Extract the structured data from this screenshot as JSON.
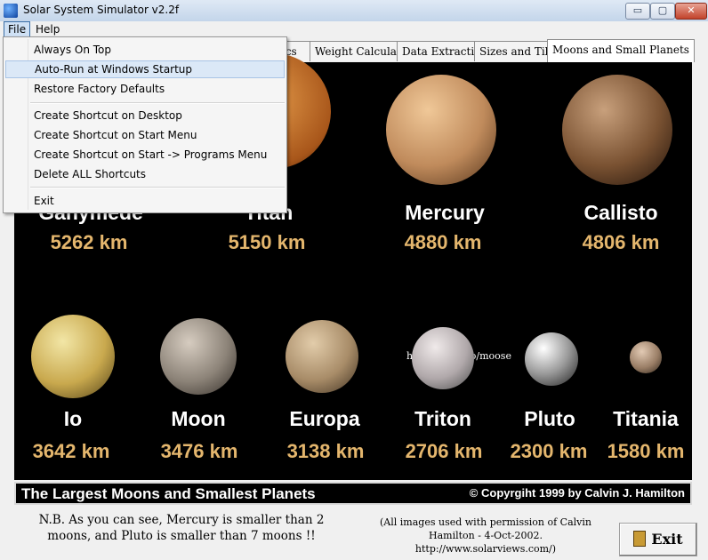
{
  "window": {
    "title": "Solar System Simulator v2.2f",
    "controls": {
      "minimize": "▭",
      "maximize": "▢",
      "close": "✕"
    }
  },
  "menubar": {
    "file": "File",
    "help": "Help"
  },
  "tabs": [
    {
      "label": "stics"
    },
    {
      "label": "Weight Calculator"
    },
    {
      "label": "Data Extraction"
    },
    {
      "label": "Sizes and Tilts"
    },
    {
      "label": "Moons and Small Planets",
      "active": true
    }
  ],
  "file_menu": {
    "items": [
      {
        "label": "Always On Top"
      },
      {
        "label": "Auto-Run at Windows Startup",
        "highlighted": true
      },
      {
        "label": "Restore Factory Defaults"
      },
      {
        "label": "Create Shortcut on Desktop"
      },
      {
        "label": "Create Shortcut on Start Menu"
      },
      {
        "label": "Create Shortcut on Start -> Programs Menu"
      },
      {
        "label": "Delete ALL Shortcuts"
      },
      {
        "label": "Exit"
      }
    ]
  },
  "bodies_row1": [
    {
      "name": "Ganymede",
      "size": "5262 km",
      "color": "#8a7560"
    },
    {
      "name": "Titan",
      "size": "5150 km",
      "color": "#d67a2e"
    },
    {
      "name": "Mercury",
      "size": "4880 km",
      "color": "#c8976a"
    },
    {
      "name": "Callisto",
      "size": "4806 km",
      "color": "#7e5e45"
    }
  ],
  "bodies_row2": [
    {
      "name": "Io",
      "size": "3642 km",
      "color": "#d9c070"
    },
    {
      "name": "Moon",
      "size": "3476 km",
      "color": "#9e948a"
    },
    {
      "name": "Europa",
      "size": "3138 km",
      "color": "#b69a74"
    },
    {
      "name": "Triton",
      "size": "2706 km",
      "color": "#c9c3c4"
    },
    {
      "name": "Pluto",
      "size": "2300 km",
      "color": "#bdbdbd"
    },
    {
      "name": "Titania",
      "size": "1580 km",
      "color": "#b39a84"
    }
  ],
  "panel": {
    "url": "http://move.to/moose"
  },
  "footer": {
    "title": "The Largest Moons and Smallest Planets",
    "copyright": "© Copyrgiht 1999 by Calvin J. Hamilton"
  },
  "note": "N.B.  As you can see, Mercury is smaller than 2 moons, and Pluto is smaller than 7 moons !!",
  "permission": "(All images used with permission of Calvin Hamilton - 4-Oct-2002.   http://www.solarviews.com/)",
  "exit_button": {
    "label": "Exit"
  }
}
